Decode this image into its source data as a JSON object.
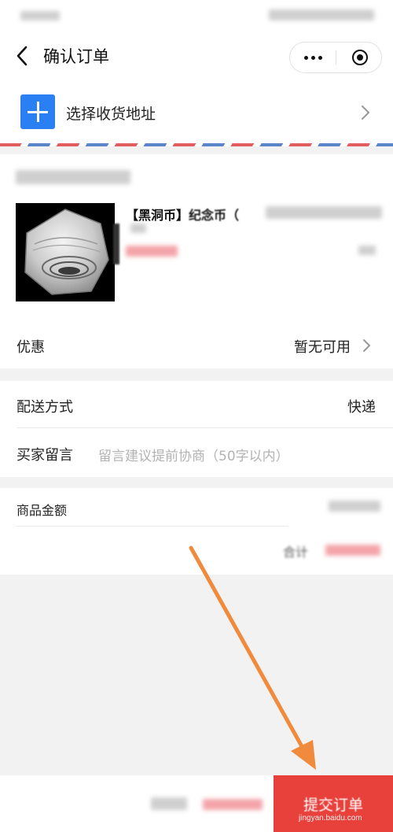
{
  "nav": {
    "title": "确认订单",
    "back_icon": "chevron-left-icon",
    "more_icon": "more-dots-icon",
    "close_icon": "target-close-icon"
  },
  "address": {
    "label": "选择收货地址",
    "icon": "plus-icon",
    "accent": "#2a7ff3"
  },
  "product": {
    "title": "【黑洞币】",
    "title_tail": "纪念币（"
  },
  "discount": {
    "label": "优惠",
    "value": "暂无可用"
  },
  "shipping": {
    "label": "配送方式",
    "value": "快递"
  },
  "message": {
    "label": "买家留言",
    "placeholder": "留言建议提前协商（50字以内）"
  },
  "amount": {
    "label": "商品金额",
    "total_label": "合计"
  },
  "footer": {
    "submit_label": "提交订单",
    "submit_color": "#e8413c",
    "watermark": "jingyan.baidu.com"
  },
  "colors": {
    "price_red": "#f3a3a8",
    "annotation_arrow": "#f08a3c"
  }
}
